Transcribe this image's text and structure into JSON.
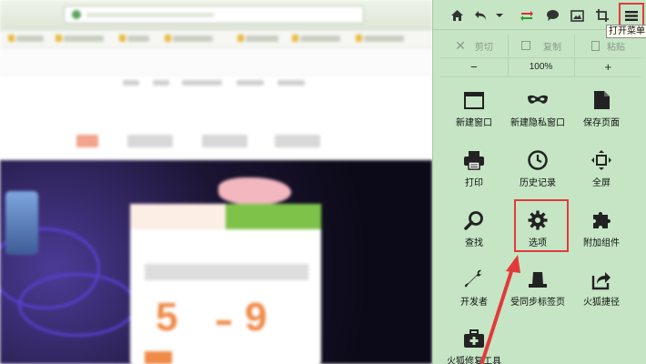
{
  "menu": {
    "tooltip": "打开菜单",
    "edit": {
      "cut": "剪切",
      "copy": "复制",
      "paste": "粘贴"
    },
    "zoom": {
      "minus": "−",
      "value": "100%",
      "plus": "+"
    },
    "items": [
      {
        "label": "新建窗口",
        "icon": "new-window-icon"
      },
      {
        "label": "新建隐私窗口",
        "icon": "mask-icon"
      },
      {
        "label": "保存页面",
        "icon": "save-page-icon"
      },
      {
        "label": "打印",
        "icon": "printer-icon"
      },
      {
        "label": "历史记录",
        "icon": "clock-icon"
      },
      {
        "label": "全屏",
        "icon": "fullscreen-icon"
      },
      {
        "label": "查找",
        "icon": "magnifier-icon"
      },
      {
        "label": "选项",
        "icon": "gear-icon"
      },
      {
        "label": "附加组件",
        "icon": "puzzle-icon"
      },
      {
        "label": "开发者",
        "icon": "wrench-icon"
      },
      {
        "label": "受同步标签页",
        "icon": "sync-tabs-icon"
      },
      {
        "label": "火狐捷径",
        "icon": "share-icon"
      },
      {
        "label": "火狐修复工具",
        "icon": "medkit-icon"
      }
    ]
  },
  "colors": {
    "panel": "#c5e5c5",
    "highlight": "#e23a3a",
    "accent_green": "#38a838"
  }
}
